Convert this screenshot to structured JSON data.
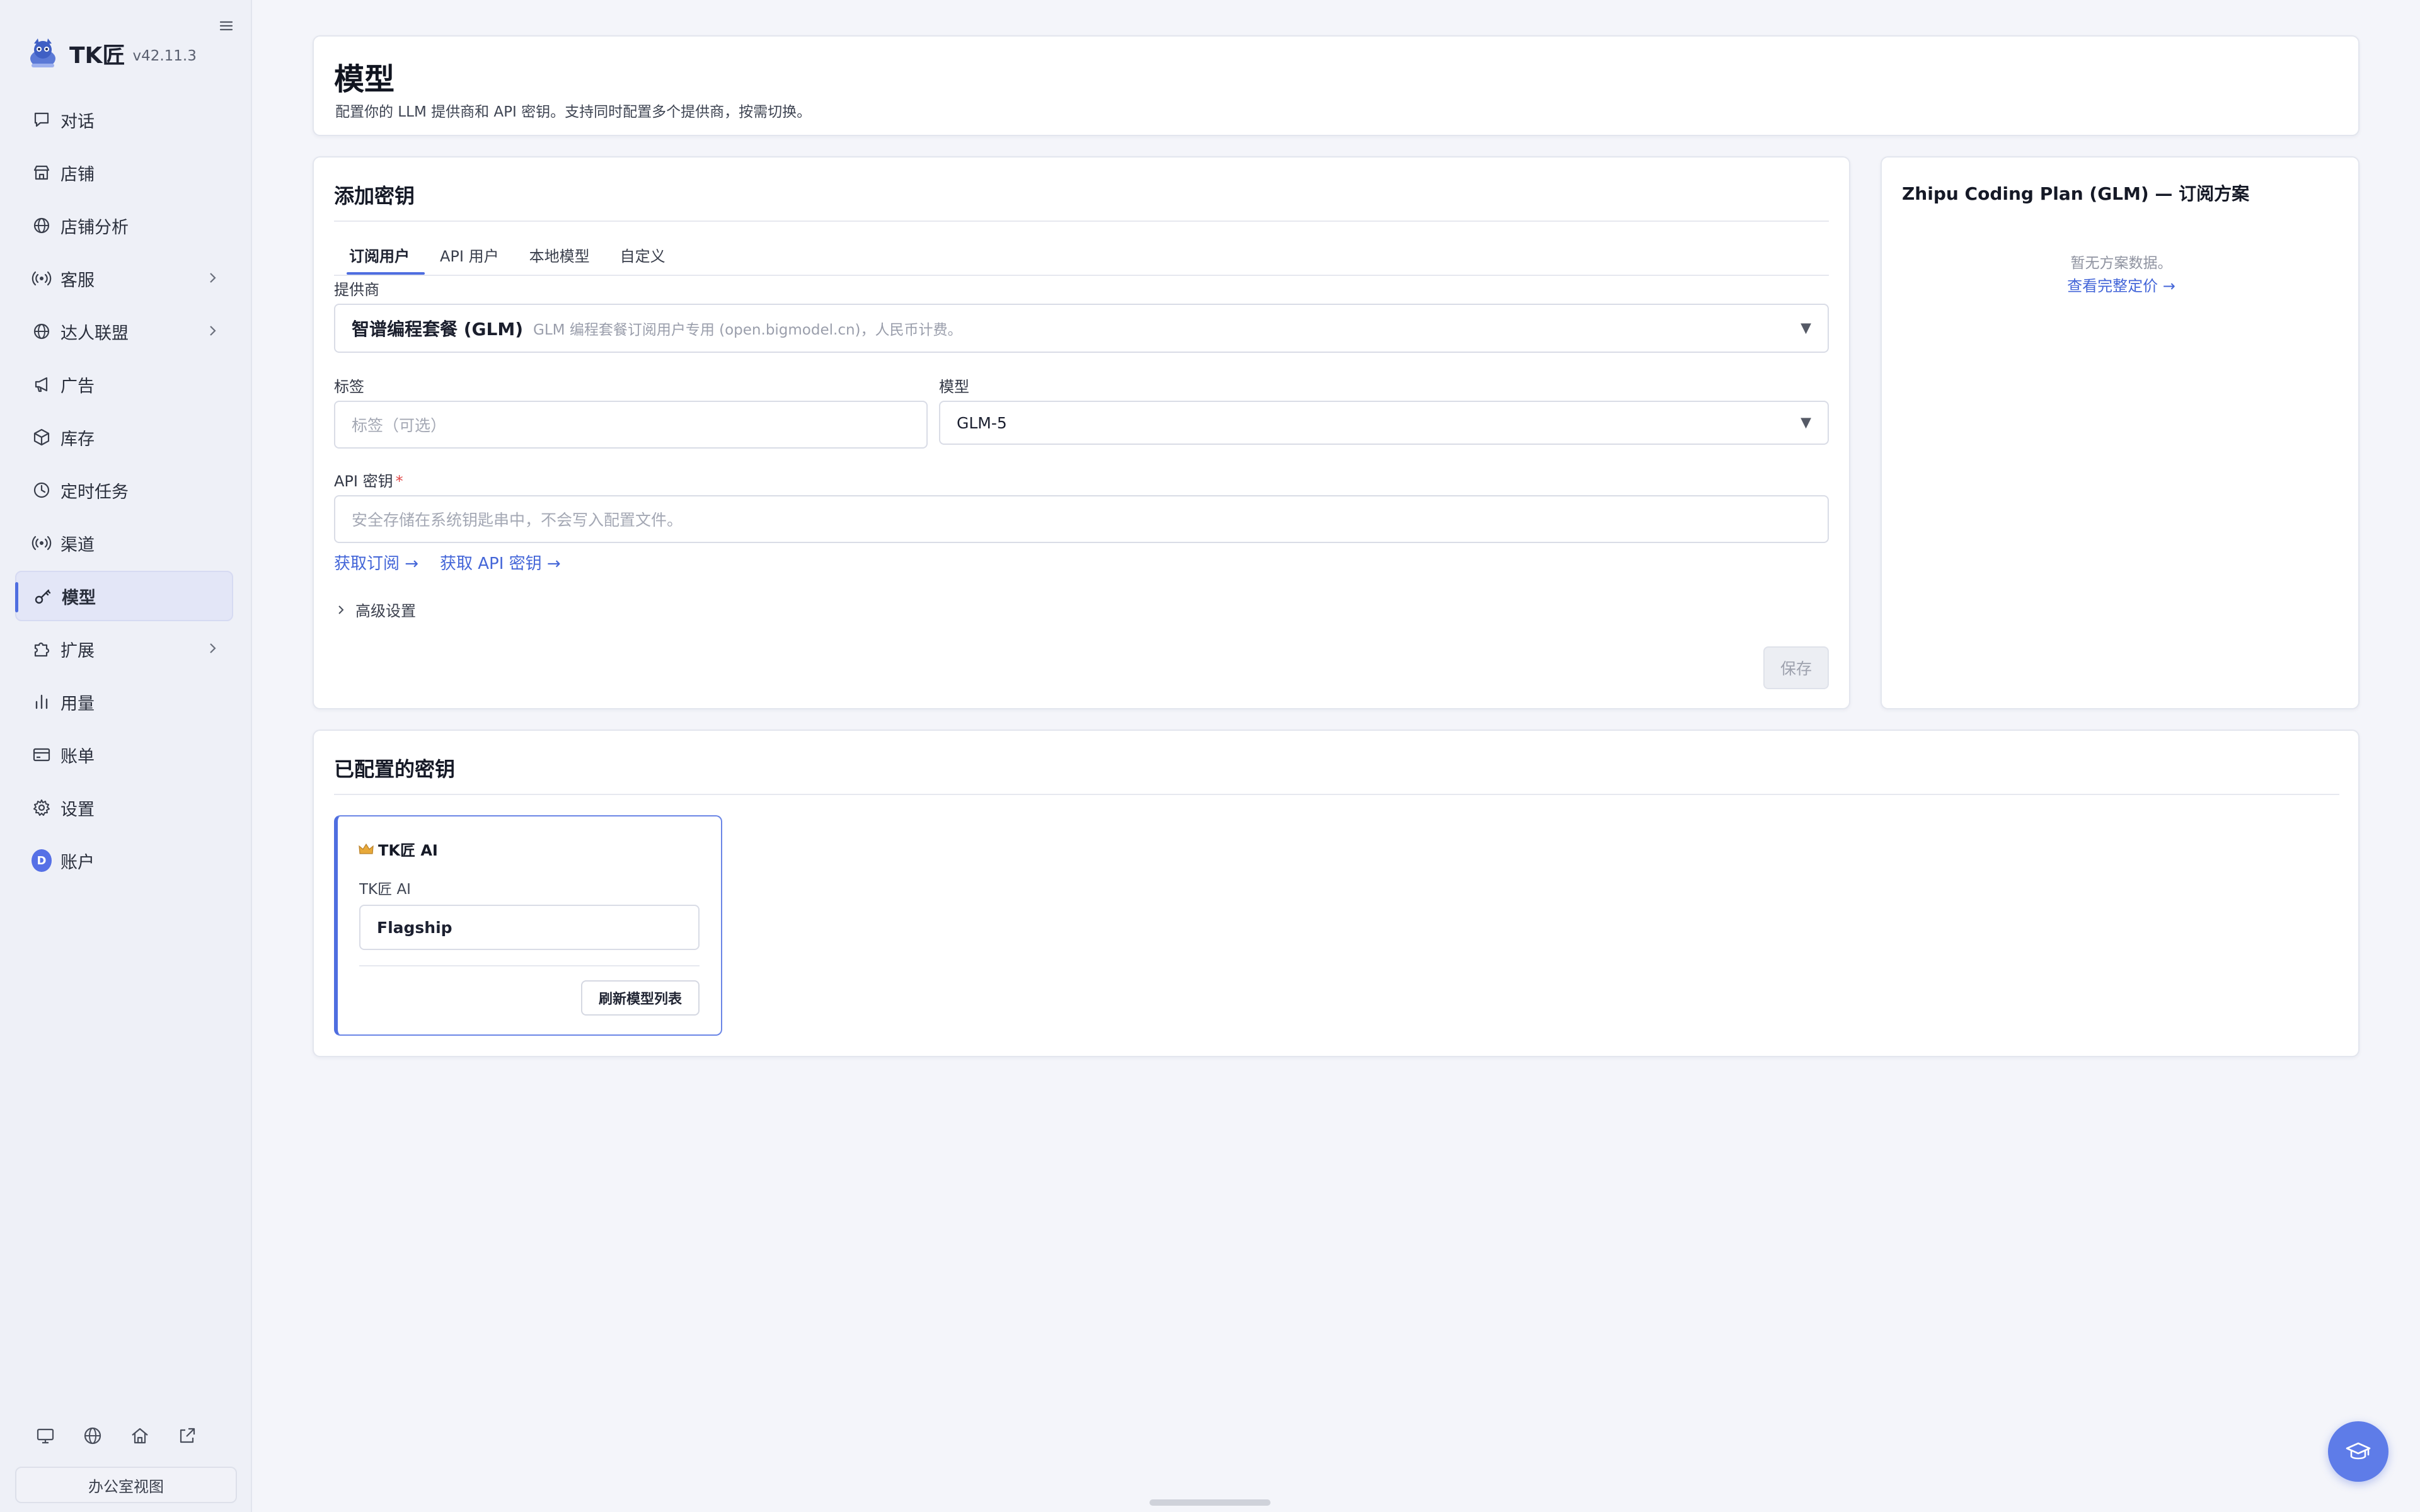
{
  "app": {
    "name": "TK匠",
    "version": "v42.11.3"
  },
  "sidebar": {
    "items": [
      {
        "label": "对话",
        "icon": "chat-icon",
        "active": false,
        "expandable": false
      },
      {
        "label": "店铺",
        "icon": "store-icon",
        "active": false,
        "expandable": false
      },
      {
        "label": "店铺分析",
        "icon": "globe-icon",
        "active": false,
        "expandable": false
      },
      {
        "label": "客服",
        "icon": "broadcast-icon",
        "active": false,
        "expandable": true
      },
      {
        "label": "达人联盟",
        "icon": "globe-icon",
        "active": false,
        "expandable": true
      },
      {
        "label": "广告",
        "icon": "megaphone-icon",
        "active": false,
        "expandable": false
      },
      {
        "label": "库存",
        "icon": "box-icon",
        "active": false,
        "expandable": false
      },
      {
        "label": "定时任务",
        "icon": "clock-icon",
        "active": false,
        "expandable": false
      },
      {
        "label": "渠道",
        "icon": "broadcast-icon",
        "active": false,
        "expandable": false
      },
      {
        "label": "模型",
        "icon": "key-icon",
        "active": true,
        "expandable": false
      },
      {
        "label": "扩展",
        "icon": "puzzle-icon",
        "active": false,
        "expandable": true
      },
      {
        "label": "用量",
        "icon": "bar-chart-icon",
        "active": false,
        "expandable": false
      },
      {
        "label": "账单",
        "icon": "credit-card-icon",
        "active": false,
        "expandable": false
      },
      {
        "label": "设置",
        "icon": "gear-icon",
        "active": false,
        "expandable": false
      },
      {
        "label": "账户",
        "icon": "avatar",
        "avatar_letter": "D",
        "active": false,
        "expandable": false
      }
    ],
    "bottom_icons": [
      "monitor-icon",
      "globe-icon",
      "home-icon",
      "external-link-icon"
    ],
    "office_view_label": "办公室视图"
  },
  "page": {
    "title": "模型",
    "subtitle": "配置你的 LLM 提供商和 API 密钥。支持同时配置多个提供商，按需切换。"
  },
  "add_key": {
    "title": "添加密钥",
    "tabs": [
      "订阅用户",
      "API 用户",
      "本地模型",
      "自定义"
    ],
    "active_tab": 0,
    "provider_label": "提供商",
    "provider_name": "智谱编程套餐 (GLM)",
    "provider_desc": "GLM 编程套餐订阅用户专用 (open.bigmodel.cn)，人民币计费。",
    "tag_label": "标签",
    "tag_placeholder": "标签（可选）",
    "model_label": "模型",
    "model_value": "GLM-5",
    "api_key_label": "API 密钥",
    "api_key_required": "*",
    "api_key_placeholder": "安全存储在系统钥匙串中，不会写入配置文件。",
    "link_subscribe": "获取订阅 →",
    "link_api_key": "获取 API 密钥 →",
    "advanced_label": "高级设置",
    "save_label": "保存"
  },
  "plan": {
    "title": "Zhipu Coding Plan (GLM) — 订阅方案",
    "empty_text": "暂无方案数据。",
    "pricing_link": "查看完整定价 →"
  },
  "configured": {
    "title": "已配置的密钥",
    "keys": [
      {
        "title": "TK匠 AI",
        "subtitle": "TK匠 AI",
        "model": "Flagship",
        "refresh_label": "刷新模型列表"
      }
    ]
  },
  "colors": {
    "accent": "#4f6ee0",
    "link": "#4466d8",
    "fab": "#5e7ce8"
  }
}
